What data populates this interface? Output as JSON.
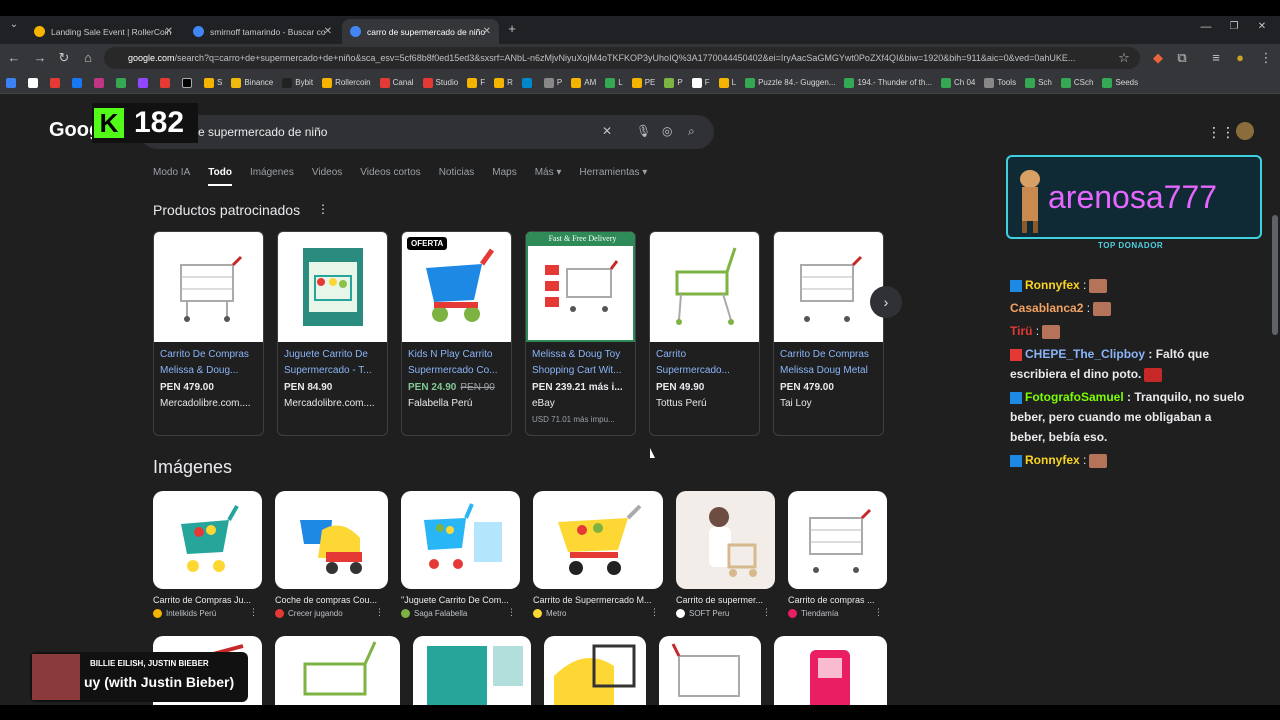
{
  "browser": {
    "tabs": [
      {
        "title": "Landing Sale Event | RollerCoin",
        "color": "#f4b400"
      },
      {
        "title": "smirnoff tamarindo - Buscar co",
        "color": "#4285f4"
      },
      {
        "title": "carro de supermercado de niño",
        "color": "#4285f4"
      }
    ],
    "new_tab": "+",
    "url_host": "google.com",
    "url_rest": "/search?q=carro+de+supermercado+de+niño&sca_esv=5cf68b8f0ed15ed3&sxsrf=ANbL-n6zMjvNiyuXojM4oTKFKOP3yUhoIQ%3A1770044450402&ei=IryAacSaGMGYwt0PoZXf4QI&biw=1920&bih=911&aic=0&ved=0ahUKE...",
    "bookmarks": [
      "S",
      "Binance",
      "Bybit",
      "Rollercoin",
      "Canal",
      "Studio",
      "F",
      "R",
      "P",
      "AM",
      "L",
      "PE",
      "P",
      "F",
      "L",
      "Puzzle 84.- Guggen...",
      "194.- Thunder of th...",
      "Ch 04",
      "Tools",
      "Sch",
      "CSch",
      "Seeds"
    ]
  },
  "overlay": {
    "kick_count": "182",
    "kick_logo": "K",
    "donor_name": "arenosa777",
    "donor_tag": "TOP DONADOR",
    "music_artist": "BILLIE EILISH, JUSTIN BIEBER",
    "music_song": "uy (with Justin Bieber)"
  },
  "google": {
    "logo": "Goog",
    "query": "e supermercado de niño",
    "tabs": [
      "Modo IA",
      "Todo",
      "Imágenes",
      "Videos",
      "Videos cortos",
      "Noticias",
      "Maps",
      "Más ▾",
      "Herramientas ▾"
    ],
    "sponsored_title": "Productos patrocinados",
    "images_title": "Imágenes",
    "products": [
      {
        "title": "Carrito De Compras Melissa & Doug...",
        "price": "PEN 479.00",
        "store": "Mercadolibre.com...."
      },
      {
        "title": "Juguete Carrito De Supermercado - T...",
        "price": "PEN 84.90",
        "store": "Mercadolibre.com...."
      },
      {
        "title": "Kids N Play Carrito Supermercado Co...",
        "price": "PEN 24.90",
        "old_price": "PEN 90",
        "store": "Falabella Perú",
        "badge": "OFERTA"
      },
      {
        "title": "Melissa & Doug Toy Shopping Cart Wit...",
        "price": "PEN 239.21 más i...",
        "store": "eBay",
        "extra": "USD 71.01 más impu...",
        "banner": "Fast & Free Delivery"
      },
      {
        "title": "Carrito Supermercado...",
        "price": "PEN 49.90",
        "store": "Tottus Perú"
      },
      {
        "title": "Carrito De Compras Melissa Doug Metal",
        "price": "PEN 479.00",
        "store": "Tai Loy"
      }
    ],
    "images": [
      {
        "caption": "Carrito de Compras Ju...",
        "source": "Intelikids Perú",
        "dot": "#f4b400"
      },
      {
        "caption": "Coche de compras Cou...",
        "source": "Crecer jugando",
        "dot": "#e53935"
      },
      {
        "caption": "\"Juguete Carrito De Com...",
        "source": "Saga Falabella",
        "dot": "#7cb342"
      },
      {
        "caption": "Carrito de Supermercado M...",
        "source": "Metro",
        "dot": "#fdd835"
      },
      {
        "caption": "Carrito de supermer...",
        "source": "SOFT Peru",
        "dot": "#ffffff"
      },
      {
        "caption": "Carrito de compras ...",
        "source": "Tiendamía",
        "dot": "#e91e63"
      }
    ]
  },
  "chat": [
    {
      "user": "Ronnyfex",
      "color": "#f9d423",
      "text": ":"
    },
    {
      "user": "Casablanca2",
      "color": "#f4a261",
      "text": ":"
    },
    {
      "user": "Tirü",
      "color": "#e53935",
      "text": ":"
    },
    {
      "user": "CHEPE_The_Clipboy",
      "color": "#8ab4f8",
      "text": ": Faltó que escribiera el dino poto."
    },
    {
      "user": "FotografoSamuel",
      "color": "#7cfc00",
      "text": ": Tranquilo, no suelo beber, pero cuando me obligaban a beber, bebía eso."
    },
    {
      "user": "Ronnyfex",
      "color": "#f9d423",
      "text": ":"
    }
  ]
}
